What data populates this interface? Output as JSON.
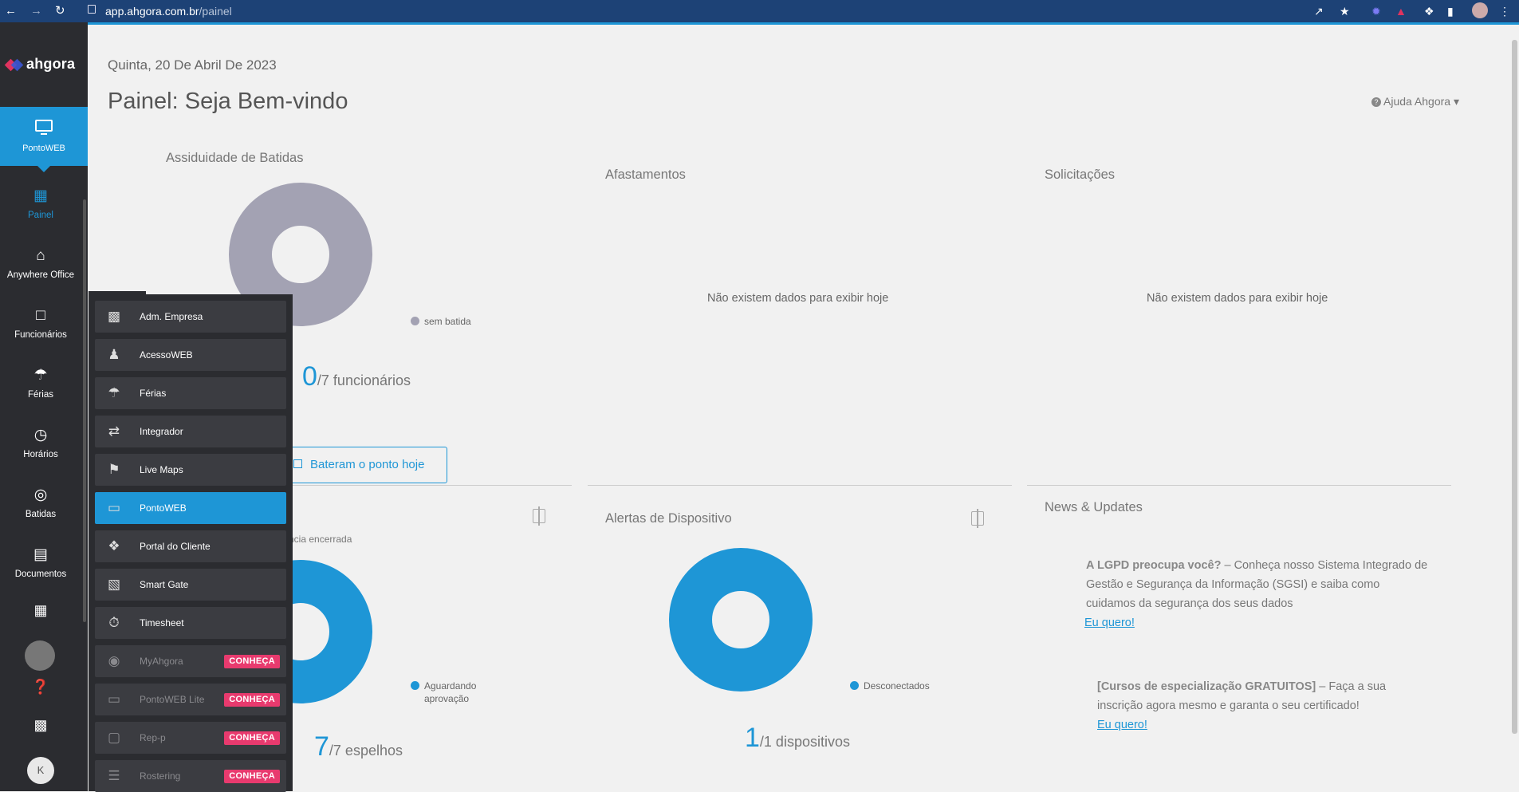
{
  "browser": {
    "url_host": "app.ahgora.com.br",
    "url_path": "/painel"
  },
  "sidebar": {
    "logo_text": "ahgora",
    "app_label": "PontoWEB",
    "items": [
      {
        "label": "Painel",
        "icon": "dashboard-icon"
      },
      {
        "label": "Anywhere Office",
        "icon": "home-office-icon"
      },
      {
        "label": "Funcionários",
        "icon": "badge-icon"
      },
      {
        "label": "Férias",
        "icon": "beach-umbrella-icon"
      },
      {
        "label": "Horários",
        "icon": "clock-icon"
      },
      {
        "label": "Batidas",
        "icon": "fingerprint-icon"
      },
      {
        "label": "Documentos",
        "icon": "document-icon"
      }
    ],
    "avatar_letter": "K"
  },
  "header": {
    "date": "Quinta, 20 De Abril De 2023",
    "title": "Painel: Seja Bem-vindo",
    "help_label": "Ajuda Ahgora"
  },
  "assiduidade": {
    "title": "Assiduidade de Batidas",
    "legend": "sem batida",
    "count": "0",
    "total": "/7 funcionários",
    "button": "Bateram o ponto hoje",
    "color": "#a3a2b3"
  },
  "afastamentos": {
    "title": "Afastamentos",
    "empty": "Não existem dados para exibir hoje"
  },
  "solicitacoes": {
    "title": "Solicitações",
    "empty": "Não existem dados para exibir hoje"
  },
  "espelhos": {
    "partial_label": "ncia encerrada",
    "legend_line1": "Aguardando",
    "legend_line2": "aprovação",
    "count": "7",
    "total": "/7 espelhos",
    "color": "#1e96d6"
  },
  "alertas": {
    "title": "Alertas de Dispositivo",
    "legend": "Desconectados",
    "count": "1",
    "total": "/1 dispositivos",
    "color": "#1e96d6"
  },
  "news": {
    "title": "News & Updates",
    "items": [
      {
        "bold": "A LGPD preocupa você?",
        "text": " – Conheça nosso Sistema Integrado de Gestão e Segurança da Informação (SGSI) e saiba como cuidamos da segurança dos seus dados",
        "link": "Eu quero!"
      },
      {
        "bold": "[Cursos de especialização GRATUITOS]",
        "text": " – Faça a sua inscrição agora mesmo e garanta o seu certificado!",
        "link": "Eu quero!"
      }
    ]
  },
  "app_menu": {
    "items": [
      {
        "label": "Adm. Empresa",
        "icon": "building-gear-icon",
        "state": "normal"
      },
      {
        "label": "AcessoWEB",
        "icon": "walking-person-icon",
        "state": "normal"
      },
      {
        "label": "Férias",
        "icon": "beach-umbrella-icon",
        "state": "normal"
      },
      {
        "label": "Integrador",
        "icon": "integration-icon",
        "state": "normal"
      },
      {
        "label": "Live Maps",
        "icon": "map-pin-icon",
        "state": "normal"
      },
      {
        "label": "PontoWEB",
        "icon": "monitor-icon",
        "state": "active"
      },
      {
        "label": "Portal do Cliente",
        "icon": "handshake-icon",
        "state": "normal"
      },
      {
        "label": "Smart Gate",
        "icon": "screen-off-icon",
        "state": "normal"
      },
      {
        "label": "Timesheet",
        "icon": "stopwatch-icon",
        "state": "normal"
      },
      {
        "label": "MyAhgora",
        "icon": "user-circle-icon",
        "state": "disabled",
        "badge": "CONHEÇA"
      },
      {
        "label": "PontoWEB Lite",
        "icon": "monitor-icon",
        "state": "disabled",
        "badge": "CONHEÇA"
      },
      {
        "label": "Rep-p",
        "icon": "briefcase-icon",
        "state": "disabled",
        "badge": "CONHEÇA"
      },
      {
        "label": "Rostering",
        "icon": "list-icon",
        "state": "disabled",
        "badge": "CONHEÇA"
      }
    ]
  }
}
